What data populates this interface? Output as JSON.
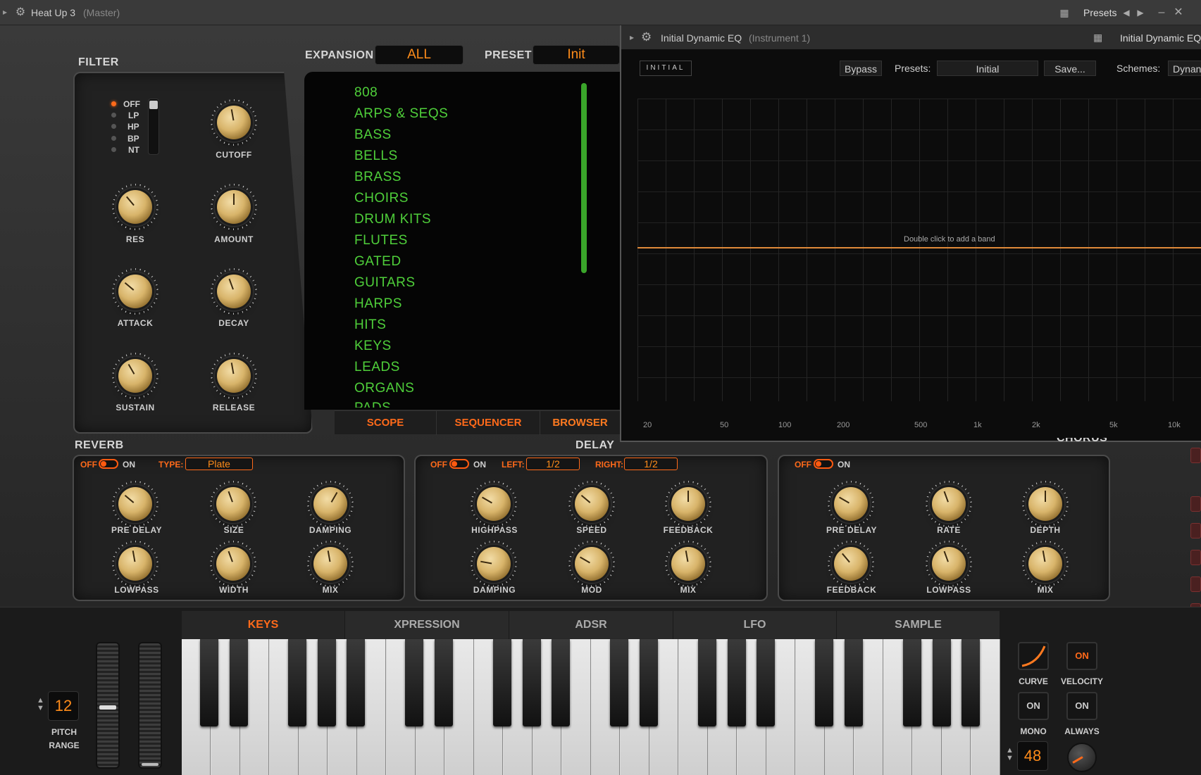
{
  "window": {
    "title": "Heat Up 3",
    "subtitle": "(Master)",
    "presets_label": "Presets"
  },
  "filter": {
    "title": "FILTER",
    "modes": [
      "OFF",
      "LP",
      "HP",
      "BP",
      "NT"
    ],
    "knobs": [
      "CUTOFF",
      "RES",
      "AMOUNT",
      "ATTACK",
      "DECAY",
      "SUSTAIN",
      "RELEASE"
    ]
  },
  "top": {
    "expansion_label": "EXPANSION",
    "expansion_value": "ALL",
    "preset_label": "PRESET",
    "preset_value": "Init"
  },
  "browser": {
    "items": [
      "808",
      "ARPS & SEQS",
      "BASS",
      "BELLS",
      "BRASS",
      "CHOIRS",
      "DRUM KITS",
      "FLUTES",
      "GATED",
      "GUITARS",
      "HARPS",
      "HITS",
      "KEYS",
      "LEADS",
      "ORGANS",
      "PADS"
    ],
    "tabs": [
      "SCOPE",
      "SEQUENCER",
      "BROWSER"
    ]
  },
  "eq": {
    "title": "Initial Dynamic EQ",
    "subtitle": "(Instrument 1)",
    "right_title": "Initial Dynamic EQ",
    "logo": "INITIAL",
    "bypass": "Bypass",
    "presets_label": "Presets:",
    "presets_value": "Initial",
    "save": "Save...",
    "schemes_label": "Schemes:",
    "schemes_value": "Dynan",
    "hint": "Double click to add a band",
    "freqs": [
      "20",
      "50",
      "100",
      "200",
      "500",
      "1k",
      "2k",
      "5k",
      "10k"
    ],
    "line_color": "#e08a3a"
  },
  "reverb": {
    "title": "REVERB",
    "off": "OFF",
    "on": "ON",
    "type_label": "TYPE:",
    "type_value": "Plate",
    "knobs": [
      "PRE DELAY",
      "SIZE",
      "DAMPING",
      "LOWPASS",
      "WIDTH",
      "MIX"
    ]
  },
  "delay": {
    "title": "DELAY",
    "off": "OFF",
    "on": "ON",
    "left_label": "LEFT:",
    "left_value": "1/2",
    "right_label": "RIGHT:",
    "right_value": "1/2",
    "knobs": [
      "HIGHPASS",
      "SPEED",
      "FEEDBACK",
      "DAMPING",
      "MOD",
      "MIX"
    ]
  },
  "chorus": {
    "title": "CHORUS",
    "off": "OFF",
    "on": "ON",
    "knobs": [
      "PRE DELAY",
      "RATE",
      "DEPTH",
      "FEEDBACK",
      "LOWPASS",
      "MIX"
    ]
  },
  "keyboard": {
    "tabs": [
      "KEYS",
      "XPRESSION",
      "ADSR",
      "LFO",
      "SAMPLE"
    ],
    "pitch_value": "12",
    "pitch_label1": "PITCH",
    "pitch_label2": "RANGE",
    "curve_label": "CURVE",
    "velocity_btn": "ON",
    "velocity_label": "VELOCITY",
    "mono_btn": "ON",
    "mono_label": "MONO",
    "always_btn": "ON",
    "always_label": "ALWAYS",
    "voices_value": "48"
  },
  "colors": {
    "accent": "#ff6a1a",
    "browser_text": "#4fcf3a",
    "knob": "#d8b46a"
  }
}
